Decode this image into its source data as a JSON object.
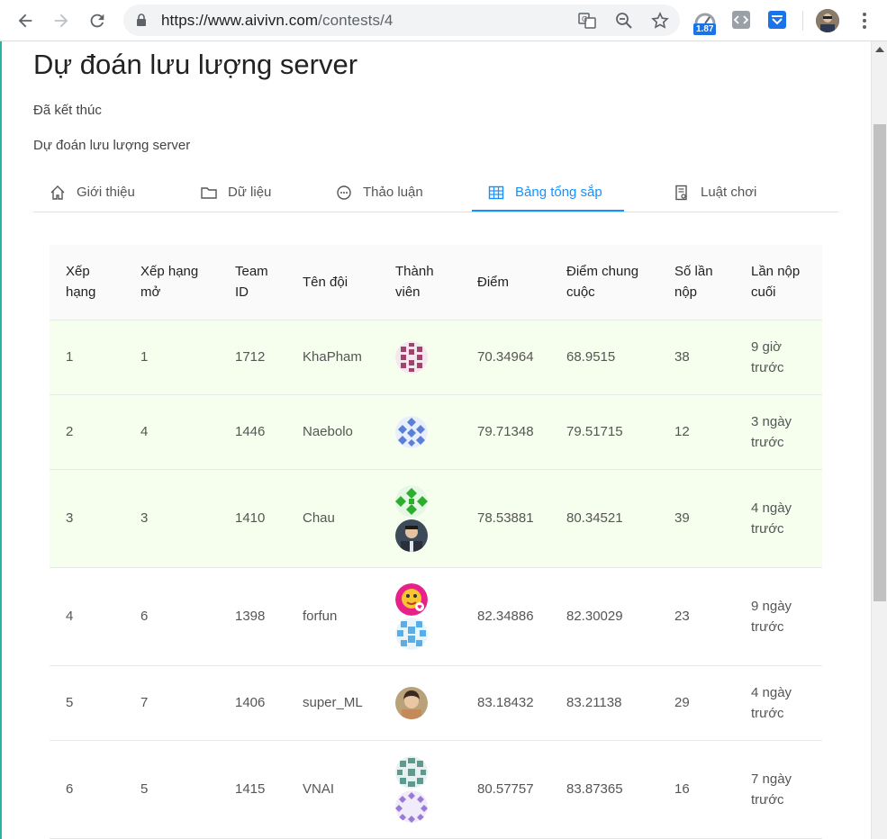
{
  "browser": {
    "url_host": "https://www.aivivn.com",
    "url_path": "/contests/4",
    "extension_badge": "1.87"
  },
  "page": {
    "title": "Dự đoán lưu lượng server",
    "status": "Đã kết thúc",
    "subtitle": "Dự đoán lưu lượng server"
  },
  "tabs": [
    {
      "label": "Giới thiệu",
      "icon": "home-icon"
    },
    {
      "label": "Dữ liệu",
      "icon": "folder-icon"
    },
    {
      "label": "Thảo luận",
      "icon": "chat-icon"
    },
    {
      "label": "Bảng tổng sắp",
      "icon": "table-icon",
      "active": true
    },
    {
      "label": "Luật chơi",
      "icon": "rules-icon"
    }
  ],
  "leaderboard": {
    "columns": [
      "Xếp hạng",
      "Xếp hạng mở",
      "Team ID",
      "Tên đội",
      "Thành viên",
      "Điểm",
      "Điểm chung cuộc",
      "Số lần nộp",
      "Lần nộp cuối"
    ],
    "rows": [
      {
        "rank": "1",
        "open_rank": "1",
        "team_id": "1712",
        "team": "KhaPham",
        "score": "70.34964",
        "final_score": "68.9515",
        "submissions": "38",
        "last": "9 giờ trước",
        "highlight": true
      },
      {
        "rank": "2",
        "open_rank": "4",
        "team_id": "1446",
        "team": "Naebolo",
        "score": "79.71348",
        "final_score": "79.51715",
        "submissions": "12",
        "last": "3 ngày trước",
        "highlight": true
      },
      {
        "rank": "3",
        "open_rank": "3",
        "team_id": "1410",
        "team": "Chau",
        "score": "78.53881",
        "final_score": "80.34521",
        "submissions": "39",
        "last": "4 ngày trước",
        "highlight": true
      },
      {
        "rank": "4",
        "open_rank": "6",
        "team_id": "1398",
        "team": "forfun",
        "score": "82.34886",
        "final_score": "82.30029",
        "submissions": "23",
        "last": "9 ngày trước",
        "highlight": false
      },
      {
        "rank": "5",
        "open_rank": "7",
        "team_id": "1406",
        "team": "super_ML",
        "score": "83.18432",
        "final_score": "83.21138",
        "submissions": "29",
        "last": "4 ngày trước",
        "highlight": false
      },
      {
        "rank": "6",
        "open_rank": "5",
        "team_id": "1415",
        "team": "VNAI",
        "score": "80.57757",
        "final_score": "83.87365",
        "submissions": "16",
        "last": "7 ngày trước",
        "highlight": false
      }
    ]
  },
  "colors": {
    "accent": "#1890ff",
    "highlight_row": "#f6ffed",
    "header_bg": "#fafafa"
  }
}
